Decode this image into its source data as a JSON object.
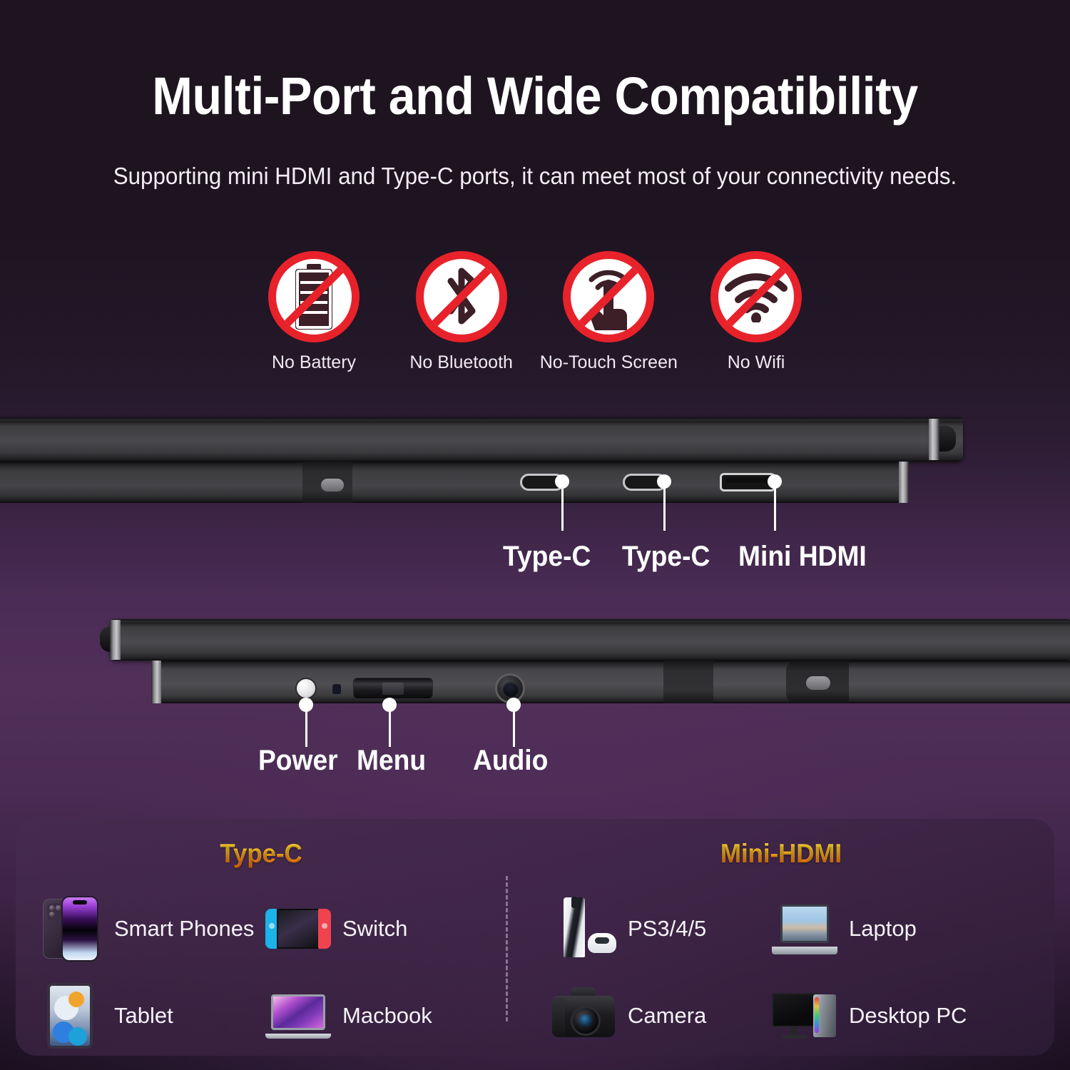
{
  "header": {
    "title": "Multi-Port and Wide Compatibility",
    "subtitle": "Supporting mini HDMI and Type-C ports, it can meet most of your connectivity needs."
  },
  "restrictions": [
    {
      "label": "No Battery",
      "icon": "no-battery-icon"
    },
    {
      "label": "No Bluetooth",
      "icon": "no-bluetooth-icon"
    },
    {
      "label": "No-Touch Screen",
      "icon": "no-touch-screen-icon"
    },
    {
      "label": "No Wifi",
      "icon": "no-wifi-icon"
    }
  ],
  "port_callouts": [
    {
      "label": "Type-C",
      "port": "usb-c-port"
    },
    {
      "label": "Type-C",
      "port": "usb-c-port"
    },
    {
      "label": "Mini HDMI",
      "port": "mini-hdmi-port"
    }
  ],
  "control_callouts": [
    {
      "label": "Power",
      "control": "power-button"
    },
    {
      "label": "Menu",
      "control": "menu-joystick"
    },
    {
      "label": "Audio",
      "control": "audio-jack"
    }
  ],
  "compatibility": {
    "groups": [
      {
        "title": "Type-C",
        "devices": [
          {
            "label": "Smart Phones",
            "icon": "smartphone-icon"
          },
          {
            "label": "Switch",
            "icon": "nintendo-switch-icon"
          },
          {
            "label": "Tablet",
            "icon": "tablet-icon"
          },
          {
            "label": "Macbook",
            "icon": "macbook-icon"
          }
        ]
      },
      {
        "title": "Mini-HDMI",
        "devices": [
          {
            "label": "PS3/4/5",
            "icon": "playstation-icon"
          },
          {
            "label": "Laptop",
            "icon": "laptop-icon"
          },
          {
            "label": "Camera",
            "icon": "dslr-camera-icon"
          },
          {
            "label": "Desktop PC",
            "icon": "desktop-pc-icon"
          }
        ]
      }
    ]
  },
  "colors": {
    "prohibition_red": "#e8222a",
    "heading_gradient_start": "#FFE24A",
    "heading_gradient_end": "#F06907",
    "text_white": "#ffffff",
    "background_top": "#1d141f",
    "background_mid": "#503059"
  }
}
